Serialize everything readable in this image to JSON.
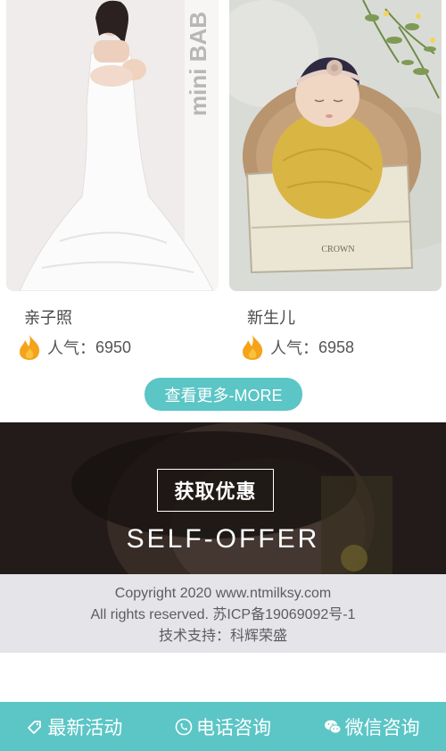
{
  "gallery": {
    "items": [
      {
        "title": "亲子照",
        "popularity_label": "人气：",
        "popularity_value": "6950",
        "watermark": "mini BAB"
      },
      {
        "title": "新生儿",
        "popularity_label": "人气：",
        "popularity_value": "6958",
        "crate_text": "CROWN"
      }
    ]
  },
  "more_button": {
    "label": "查看更多-MORE"
  },
  "promo": {
    "title": "获取优惠",
    "subtitle": "SELF-OFFER"
  },
  "footer": {
    "line1": "Copyright 2020 www.ntmilksy.com",
    "line2": "All rights reserved. 苏ICP备19069092号-1",
    "line3": "技术支持：科辉荣盛"
  },
  "bottom_nav": {
    "items": [
      {
        "label": "最新活动",
        "icon": "tag-icon"
      },
      {
        "label": "电话咨询",
        "icon": "phone-icon"
      },
      {
        "label": "微信咨询",
        "icon": "wechat-icon"
      }
    ]
  },
  "colors": {
    "accent": "#5cc5c6",
    "footer_bg": "#e5e4e9",
    "fire": "#f5a31a"
  }
}
